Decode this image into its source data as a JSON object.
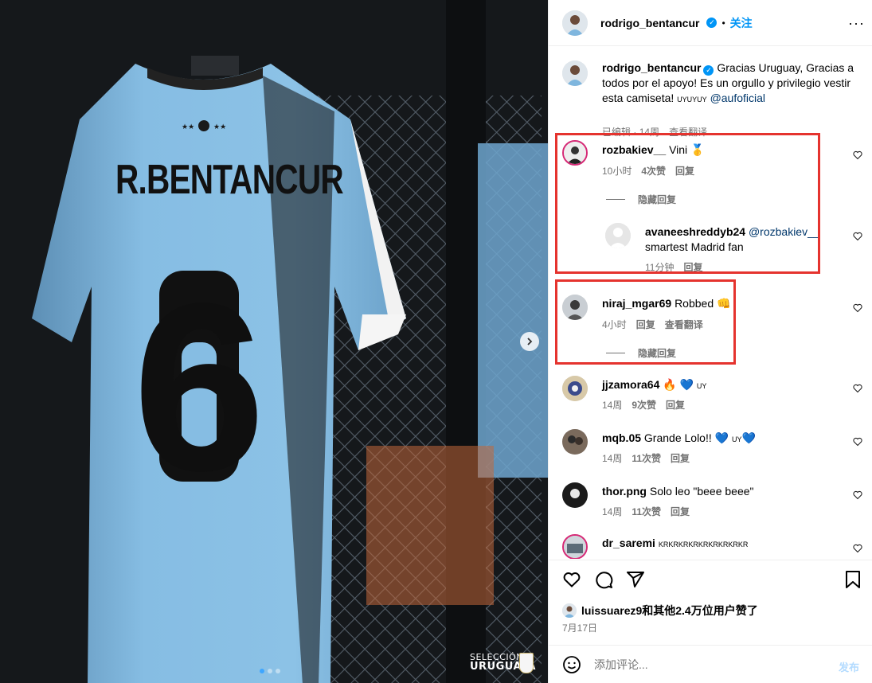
{
  "post": {
    "author": "rodrigo_bentancur",
    "follow_label": "关注",
    "separator": "•",
    "more": "···"
  },
  "photo": {
    "jersey_name": "R.BENTANCUR",
    "jersey_number": "6",
    "brand_line1": "SELECCIÓN",
    "brand_line2": "URUGUAYA"
  },
  "caption": {
    "username": "rodrigo_bentancur",
    "text_before": "Gracias Uruguay, Gracias a todos por el apoyo! Es un orgullo y privilegio vestir esta camiseta! ",
    "flags": "UYUYUY",
    "mention": "@aufoficial",
    "edited": "已编辑",
    "dot": "·",
    "age": "14周",
    "translate": "查看翻译"
  },
  "comments": [
    {
      "username": "rozbakiev__",
      "text": "Vini 🥇",
      "age": "10小时",
      "likes": "4次赞",
      "reply": "回复",
      "hide_replies": "隐藏回复",
      "reply_item": {
        "username": "avaneeshreddyb24",
        "mention": "@rozbakiev__",
        "text": "smartest Madrid fan",
        "age": "11分钟",
        "reply": "回复"
      }
    },
    {
      "username": "niraj_mgar69",
      "text": "Robbed 👊",
      "age": "4小时",
      "reply": "回复",
      "translate": "查看翻译",
      "hide_replies": "隐藏回复"
    },
    {
      "username": "jjzamora64",
      "text": "🔥 💙",
      "flag": "UY",
      "age": "14周",
      "likes": "9次赞",
      "reply": "回复"
    },
    {
      "username": "mqb.05",
      "text": "Grande Lolo!! 💙",
      "flag": "UY",
      "text_after": "💙",
      "age": "14周",
      "likes": "11次赞",
      "reply": "回复"
    },
    {
      "username": "thor.png",
      "text": "Solo leo \"beee beee\"",
      "age": "14周",
      "likes": "11次赞",
      "reply": "回复"
    },
    {
      "username": "dr_saremi",
      "text": "KRKRKRKRKRKRKRKRKR"
    }
  ],
  "likes": {
    "text": "luissuarez9和其他2.4万位用户赞了"
  },
  "date": "7月17日",
  "add_comment": {
    "placeholder": "添加评论...",
    "post_label": "发布"
  },
  "icons": [
    "heart-icon",
    "comment-icon",
    "share-icon",
    "bookmark-icon",
    "emoji-icon",
    "chevron-right-icon",
    "verified-icon",
    "more-icon"
  ],
  "colors": {
    "accent": "#0095f6",
    "highlight": "#e5332e",
    "jersey": "#7fb6de"
  }
}
